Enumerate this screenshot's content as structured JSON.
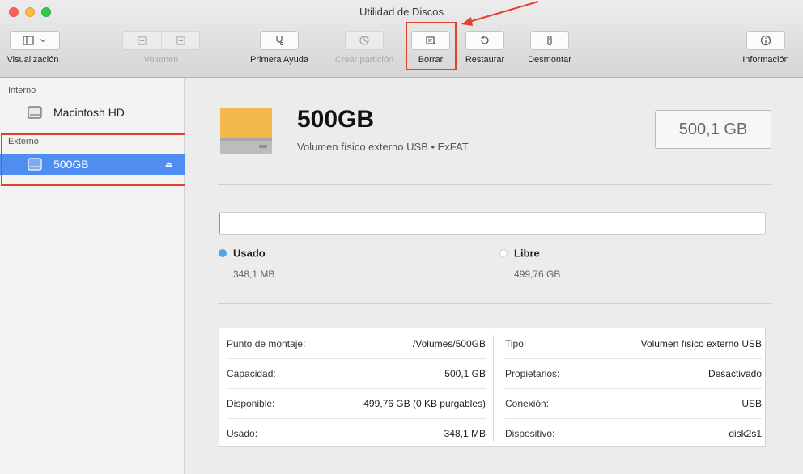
{
  "window": {
    "title": "Utilidad de Discos"
  },
  "toolbar": {
    "view_label": "Visualización",
    "volume_label": "Volumen",
    "first_aid_label": "Primera Ayuda",
    "partition_label": "Crear partición",
    "erase_label": "Borrar",
    "restore_label": "Restaurar",
    "unmount_label": "Desmontar",
    "info_label": "Información"
  },
  "sidebar": {
    "internal_header": "Interno",
    "internal_items": [
      {
        "label": "Macintosh HD"
      }
    ],
    "external_header": "Externo",
    "external_items": [
      {
        "label": "500GB",
        "selected": true
      }
    ]
  },
  "volume": {
    "name": "500GB",
    "description": "Volumen físico externo USB • ExFAT",
    "capacity_display": "500,1 GB",
    "used_fraction": 0.0007
  },
  "usage": {
    "used": {
      "name": "Usado",
      "value": "348,1 MB",
      "color": "#4fa3e8"
    },
    "free": {
      "name": "Libre",
      "value": "499,76 GB",
      "color": "#ffffff"
    }
  },
  "info": {
    "left": [
      {
        "key": "Punto de montaje:",
        "value": "/Volumes/500GB"
      },
      {
        "key": "Capacidad:",
        "value": "500,1 GB"
      },
      {
        "key": "Disponible:",
        "value": "499,76 GB (0 KB purgables)"
      },
      {
        "key": "Usado:",
        "value": "348,1 MB"
      }
    ],
    "right": [
      {
        "key": "Tipo:",
        "value": "Volumen físico externo USB"
      },
      {
        "key": "Propietarios:",
        "value": "Desactivado"
      },
      {
        "key": "Conexión:",
        "value": "USB"
      },
      {
        "key": "Dispositivo:",
        "value": "disk2s1"
      }
    ]
  },
  "colors": {
    "accent": "#4f8ef0",
    "highlight": "#e0412f"
  }
}
